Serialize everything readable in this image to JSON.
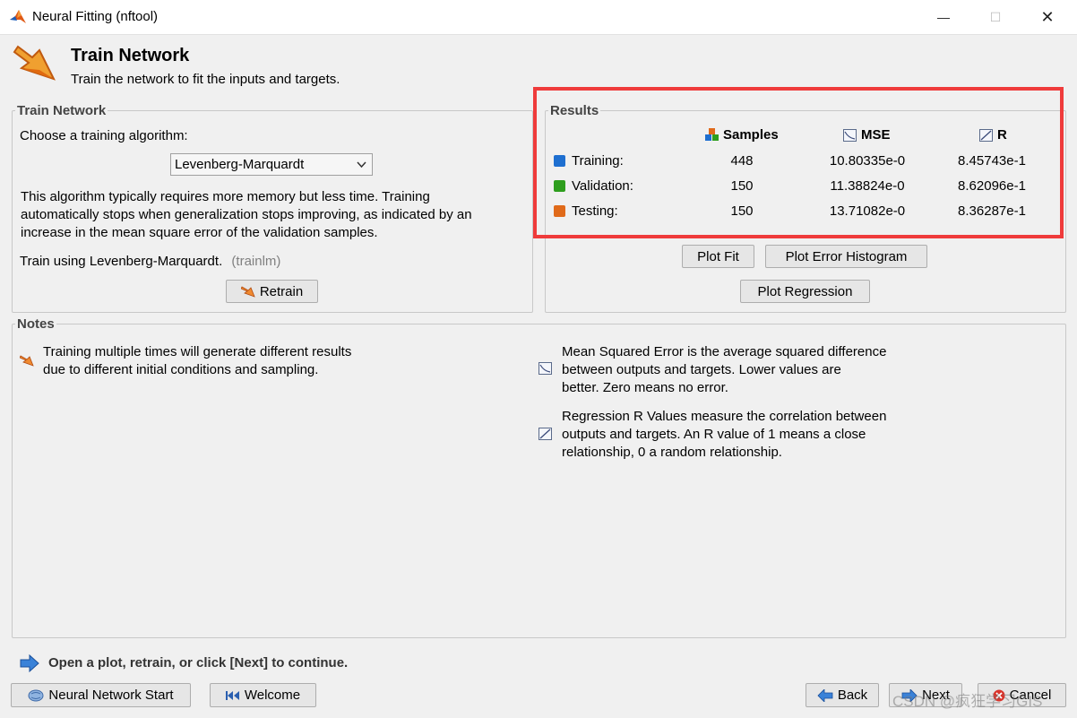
{
  "window": {
    "title": "Neural Fitting (nftool)",
    "minimize_glyph": "—",
    "maximize_glyph": "☐",
    "close_glyph": "✕"
  },
  "header": {
    "title": "Train Network",
    "subtitle": "Train the network to fit the inputs and targets."
  },
  "train_network": {
    "legend": "Train Network",
    "choose_label": "Choose a training algorithm:",
    "algorithm_selected": "Levenberg-Marquardt",
    "description_lines": [
      "This algorithm typically requires more memory but less time. Training",
      "automatically stops when generalization stops improving, as indicated by an",
      "increase in the mean square error of the validation samples."
    ],
    "train_using": "Train using Levenberg-Marquardt.",
    "train_fn": "(trainlm)",
    "retrain_label": "Retrain"
  },
  "results": {
    "legend": "Results",
    "col_samples": "Samples",
    "col_mse": "MSE",
    "col_r": "R",
    "rows": [
      {
        "label": "Training:",
        "samples": "448",
        "mse": "10.80335e-0",
        "r": "8.45743e-1",
        "color": "#1e6fd0"
      },
      {
        "label": "Validation:",
        "samples": "150",
        "mse": "11.38824e-0",
        "r": "8.62096e-1",
        "color": "#2e9e1e"
      },
      {
        "label": "Testing:",
        "samples": "150",
        "mse": "13.71082e-0",
        "r": "8.36287e-1",
        "color": "#e06a1a"
      }
    ],
    "plot_fit": "Plot Fit",
    "plot_error_histogram": "Plot Error Histogram",
    "plot_regression": "Plot Regression",
    "highlight_color": "#ef3b3b"
  },
  "notes": {
    "legend": "Notes",
    "note1_lines": [
      "Training multiple times will generate different results",
      "due to different initial conditions and sampling."
    ],
    "note2_lines": [
      "Mean Squared Error is the average squared difference",
      "between outputs and targets. Lower values are",
      "better. Zero means no error."
    ],
    "note3_lines": [
      "Regression R Values measure the correlation between",
      "outputs and targets. An R value of 1 means a close",
      "relationship, 0 a random relationship."
    ]
  },
  "footer": {
    "hint": "Open a plot, retrain, or click [Next] to continue.",
    "nn_start": "Neural Network Start",
    "welcome": "Welcome",
    "back": "Back",
    "next": "Next",
    "cancel": "Cancel",
    "watermark": "CSDN @疯狂学习GIS"
  }
}
